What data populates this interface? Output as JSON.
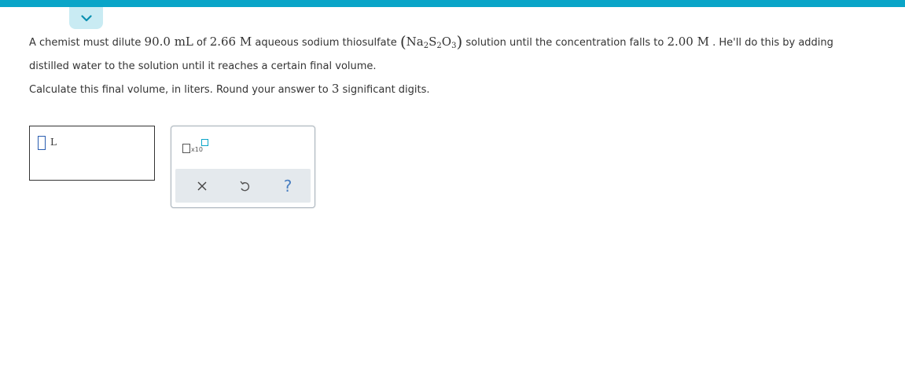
{
  "colors": {
    "accent": "#0aa5c8",
    "tab_background": "#c9ebf3",
    "toolbar_background": "#e4e9ed",
    "slot_border": "#2a5db0"
  },
  "header": {
    "collapse_icon": "chevron-down-icon"
  },
  "problem": {
    "t1": "A chemist must dilute ",
    "volume_initial": "90.0 mL",
    "t2": " of ",
    "conc_initial": "2.66 M",
    "t3": " aqueous sodium thiosulfate ",
    "paren_open": "(",
    "f_na": "Na",
    "f_2a": "2",
    "f_s": "S",
    "f_2b": "2",
    "f_o": "O",
    "f_3": "3",
    "paren_close": ")",
    "t4": " solution until the concentration falls to ",
    "conc_final": "2.00 M",
    "t5": " . He'll do this by adding",
    "line2": "distilled water to the solution until it reaches a certain final volume."
  },
  "instruction": {
    "t1": "Calculate this final volume, in liters. Round your answer to ",
    "digits": "3",
    "t2": " significant digits."
  },
  "answer": {
    "value": "",
    "unit": "L"
  },
  "tools": {
    "scientific_label": "x10",
    "clear_icon": "close-icon",
    "undo_icon": "undo-icon",
    "help_label": "?"
  }
}
